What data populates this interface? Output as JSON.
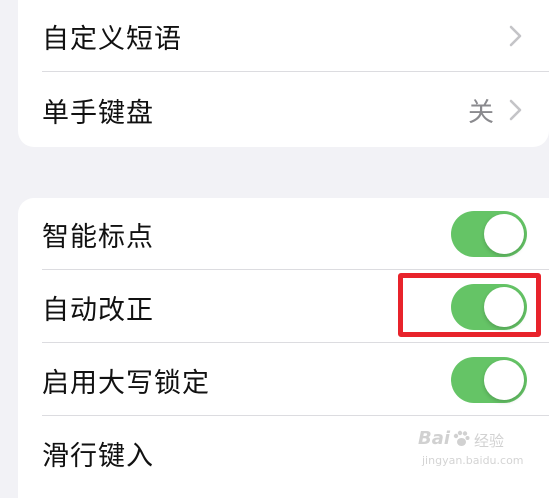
{
  "group1": {
    "rows": [
      {
        "label": "自定义短语",
        "value": "",
        "control": "chevron"
      },
      {
        "label": "单手键盘",
        "value": "关",
        "control": "chevron"
      }
    ]
  },
  "group2": {
    "rows": [
      {
        "label": "智能标点",
        "control": "toggle",
        "on": true
      },
      {
        "label": "自动改正",
        "control": "toggle",
        "on": true,
        "highlighted": true
      },
      {
        "label": "启用大写锁定",
        "control": "toggle",
        "on": true
      },
      {
        "label": "滑行键入",
        "control": "toggle",
        "on": true
      }
    ]
  },
  "colors": {
    "toggle_on": "#65c466",
    "highlight": "#e8232b",
    "background": "#f2f2f6"
  },
  "watermark": {
    "logo": "Bai",
    "jingyan": "经验",
    "url": "jingyan.baidu.com"
  }
}
